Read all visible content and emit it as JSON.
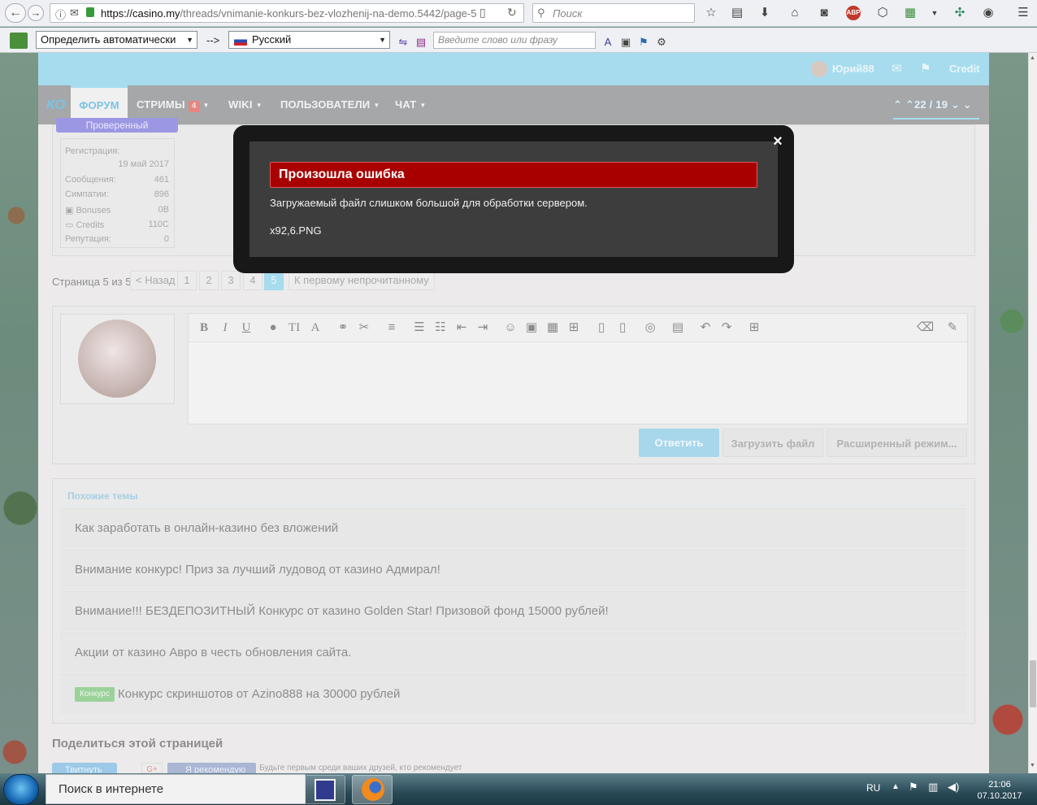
{
  "browser": {
    "url_host": "https://casino.my",
    "url_path": "/threads/vnimanie-konkurs-bez-vlozhenij-na-demo.5442/page-5",
    "search_placeholder": "Поиск",
    "abp_label": "ABP"
  },
  "translator": {
    "source_lang": "Определить автоматически",
    "arrow": "-->",
    "target_lang": "Русский",
    "phrase_placeholder": "Введите слово или фразу"
  },
  "site": {
    "user_name": "Юрий88",
    "credit_label": "Credit",
    "nav": [
      {
        "label": "ФОРУМ"
      },
      {
        "label": "СТРИМЫ",
        "badge": "4"
      },
      {
        "label": "WIKI"
      },
      {
        "label": "ПОЛЬЗОВАТЕЛИ"
      },
      {
        "label": "ЧАТ"
      }
    ],
    "thread_pos": "22 / 19",
    "user_status": "Проверенный",
    "stats": [
      {
        "label": "Регистрация:",
        "value": "19 май 2017"
      },
      {
        "label": "Сообщения:",
        "value": "461"
      },
      {
        "label": "Симпатии:",
        "value": "896"
      },
      {
        "label": "Bonuses",
        "value": "0B"
      },
      {
        "label": "Credits",
        "value": "110C"
      },
      {
        "label": "Репутация:",
        "value": "0"
      }
    ],
    "pagination": {
      "label": "Страница 5 из 5",
      "prev": "< Назад",
      "pages": [
        "1",
        "2",
        "3",
        "4",
        "5"
      ],
      "current": "5",
      "first_unread": "К первому непрочитанному"
    },
    "editor_buttons": {
      "reply": "Ответить",
      "upload": "Загрузить файл",
      "advanced": "Расширенный режим..."
    },
    "similar": {
      "heading": "Похожие темы",
      "items": [
        {
          "title": "Как заработать в онлайн-казино без вложений"
        },
        {
          "title": "Внимание конкурс! Приз за лучший лудовод от казино Адмирал!"
        },
        {
          "title": "Внимание!!! БЕЗДЕПОЗИТНЫЙ Конкурс от казино Golden Star! Призовой фонд 15000 рублей!"
        },
        {
          "title": "Акции от казино Авро в честь обновления сайта."
        },
        {
          "title": "Конкурс скриншотов от Azino888 на 30000 рублей",
          "tag": "Конкурс"
        }
      ]
    },
    "share": {
      "heading": "Поделиться этой страницей",
      "tweet": "Твитнуть",
      "gplus": "G+",
      "recommend": "Я рекомендую",
      "fb_text": "Будьте первым среди ваших друзей, кто рекомендует"
    }
  },
  "modal": {
    "title": "Произошла ошибка",
    "message": "Загружаемый файл слишком большой для обработки сервером.",
    "file": "x92,6.PNG",
    "close_glyph": "×"
  },
  "taskbar": {
    "search": "Поиск в интернете",
    "lang": "RU",
    "time": "21:06",
    "date": "07.10.2017"
  },
  "colors": {
    "modal_error_red": "#a80000",
    "topbar_blue": "#a6dcee",
    "nav_gray": "#a6a7a9"
  }
}
